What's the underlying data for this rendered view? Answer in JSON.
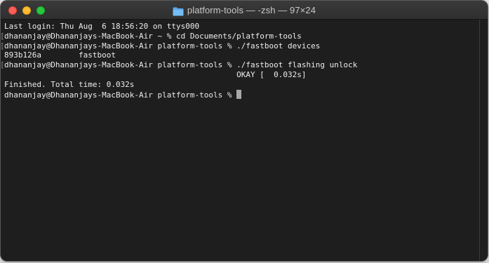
{
  "window": {
    "title": "platform-tools — -zsh — 97×24",
    "title_icon": "folder-icon",
    "folder_color": "#5aa8e8"
  },
  "terminal": {
    "lines": [
      {
        "mark": "",
        "text": "Last login: Thu Aug  6 18:56:20 on ttys000"
      },
      {
        "mark": "[",
        "text": "dhananjay@Dhananjays-MacBook-Air ~ % cd Documents/platform-tools"
      },
      {
        "mark": "[",
        "text": "dhananjay@Dhananjays-MacBook-Air platform-tools % ./fastboot devices"
      },
      {
        "mark": "",
        "text": "893b126a        fastboot"
      },
      {
        "mark": "[",
        "text": "dhananjay@Dhananjays-MacBook-Air platform-tools % ./fastboot flashing unlock"
      },
      {
        "mark": "",
        "text": "                                                  OKAY [  0.032s]"
      },
      {
        "mark": "",
        "text": "Finished. Total time: 0.032s"
      },
      {
        "mark": "",
        "text": "dhananjay@Dhananjays-MacBook-Air platform-tools % "
      }
    ]
  },
  "colors": {
    "background": "#1e1e1e",
    "foreground": "#ececec",
    "close": "#fe5f57",
    "minimize": "#febc2e",
    "zoom": "#28c840"
  }
}
